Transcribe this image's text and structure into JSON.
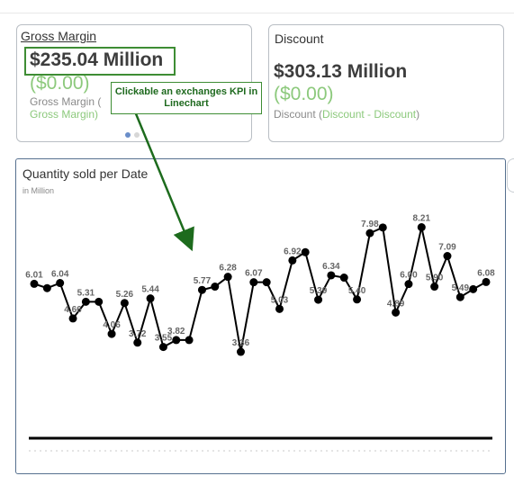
{
  "kpis": [
    {
      "title": "Gross Margin",
      "value": "$235.04 Million",
      "delta": "($0.00)",
      "sub_label": "Gross Margin (",
      "sub_label_accent": "Gross Margin)"
    },
    {
      "title": "Discount",
      "value": "$303.13 Million",
      "delta": "($0.00)",
      "sub_label": "Discount (",
      "sub_label_accent": "Discount - Discount",
      "sub_label_end": ")"
    }
  ],
  "annotation": {
    "callout_text": "Clickable an exchanges KPI in Linechart",
    "color": "#3e8d34"
  },
  "chart": {
    "title": "Quantity sold per Date",
    "unit": "in Million"
  },
  "chart_data": {
    "type": "line",
    "title": "Quantity sold per Date",
    "subtitle": "in Million",
    "x": [
      1,
      2,
      3,
      4,
      5,
      6,
      7,
      8,
      9,
      10,
      11,
      12,
      13,
      14,
      15,
      16,
      17,
      18,
      19,
      20,
      21,
      22,
      23,
      24,
      25,
      26,
      27,
      28,
      29,
      30,
      31,
      32,
      33,
      34,
      35,
      36
    ],
    "values": [
      6.01,
      5.84,
      6.04,
      4.66,
      5.31,
      5.31,
      4.06,
      5.26,
      3.72,
      5.44,
      3.55,
      3.82,
      3.82,
      5.77,
      5.9,
      6.28,
      3.36,
      6.07,
      6.07,
      5.03,
      6.92,
      7.24,
      5.39,
      6.34,
      6.25,
      5.4,
      7.98,
      8.2,
      4.89,
      6.0,
      8.21,
      5.9,
      7.09,
      5.49,
      5.8,
      6.08
    ],
    "labels": [
      "6.01",
      "",
      "6.04",
      "4.66",
      "5.31",
      "",
      "4.06",
      "5.26",
      "3.72",
      "5.44",
      "3.55",
      "3.82",
      "",
      "5.77",
      "",
      "6.28",
      "3.36",
      "6.07",
      "",
      "5.03",
      "6.92",
      "",
      "5.39",
      "6.34",
      "",
      "5.40",
      "7.98",
      "",
      "4.89",
      "6.00",
      "8.21",
      "5.90",
      "7.09",
      "5.49",
      "",
      "6.08"
    ],
    "ylim": [
      0,
      9
    ],
    "line_color": "#000000"
  },
  "carousel": {
    "pages": 2,
    "active": 1
  }
}
